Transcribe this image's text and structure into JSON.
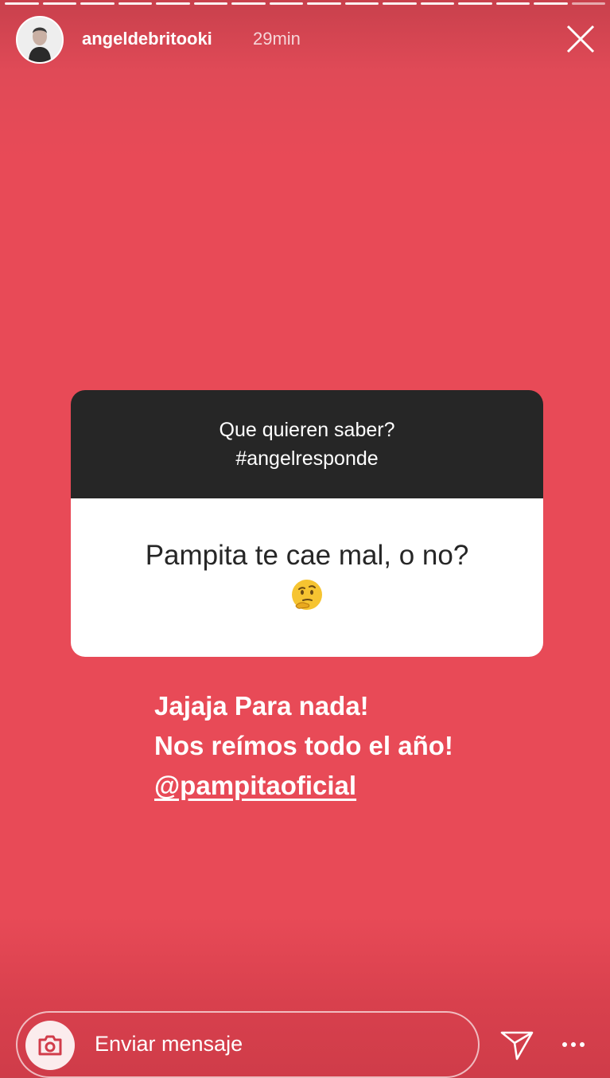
{
  "story": {
    "segments": 16,
    "segments_viewed": 15,
    "username": "angeldebritooki",
    "time_ago": "29min"
  },
  "question_sticker": {
    "prompt_line1": "Que quieren saber?",
    "prompt_line2": "#angelresponde",
    "question": "Pampita te cae mal, o no?",
    "emoji": "thinking-face"
  },
  "reply": {
    "line1": "Jajaja Para nada!",
    "line2": "Nos reímos todo el año!",
    "mention": "@pampitaoficial"
  },
  "footer": {
    "message_placeholder": "Enviar mensaje"
  },
  "colors": {
    "background": "#e84a57",
    "sticker_header": "#262626",
    "sticker_body": "#ffffff"
  }
}
